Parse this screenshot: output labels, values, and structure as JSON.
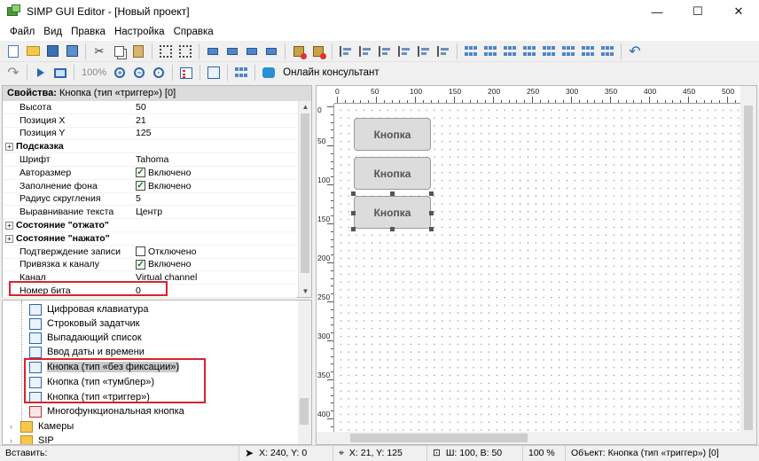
{
  "window": {
    "title": "SIMP GUI Editor - [Новый проект]",
    "minimize": "—",
    "maximize": "☐",
    "close": "✕"
  },
  "menu": [
    "Файл",
    "Вид",
    "Правка",
    "Настройка",
    "Справка"
  ],
  "toolbar2": {
    "zoom": "100%",
    "consultant": "Онлайн консультант"
  },
  "properties": {
    "title_prefix": "Свойства:",
    "title_object": " Кнопка (тип «триггер») [0]",
    "rows": [
      {
        "name": "Высота",
        "value": "50"
      },
      {
        "name": "Позиция X",
        "value": "21"
      },
      {
        "name": "Позиция Y",
        "value": "125"
      },
      {
        "name": "Подсказка",
        "group": true
      },
      {
        "name": "Шрифт",
        "value": "Tahoma"
      },
      {
        "name": "Авторазмер",
        "value": "Включено",
        "check": true
      },
      {
        "name": "Заполнение фона",
        "value": "Включено",
        "check": true
      },
      {
        "name": "Радиус скругления",
        "value": "5"
      },
      {
        "name": "Выравнивание текста",
        "value": "Центр"
      },
      {
        "name": "Состояние \"отжато\"",
        "group": true
      },
      {
        "name": "Состояние \"нажато\"",
        "group": true
      },
      {
        "name": "Подтверждение записи",
        "value": "Отключено",
        "check": false
      },
      {
        "name": "Привязка к каналу",
        "value": "Включено",
        "check": true
      },
      {
        "name": "Канал",
        "value": "Virtual channel"
      },
      {
        "name": "Номер бита",
        "value": "0"
      }
    ],
    "group_sign": "+",
    "check_mark": "✓"
  },
  "tree": {
    "items": [
      {
        "label": "Цифровая клавиатура",
        "icon": "keypad-icon"
      },
      {
        "label": "Строковый задатчик",
        "icon": "string-input-icon"
      },
      {
        "label": "Выпадающий список",
        "icon": "dropdown-icon"
      },
      {
        "label": "Ввод даты и времени",
        "icon": "datetime-icon"
      },
      {
        "label": "Кнопка (тип «без фиксации»)",
        "icon": "button-icon",
        "selected": true
      },
      {
        "label": "Кнопка (тип «тумблер»)",
        "icon": "button-icon"
      },
      {
        "label": "Кнопка (тип «триггер»)",
        "icon": "button-icon"
      },
      {
        "label": "Многофункциональная кнопка",
        "icon": "multi-button-icon"
      },
      {
        "label": "Камеры",
        "icon": "folder-icon"
      },
      {
        "label": "SIP",
        "icon": "folder-icon"
      }
    ]
  },
  "canvas": {
    "hruler_labels": [
      "0",
      "50",
      "100",
      "150",
      "200",
      "250",
      "300",
      "350",
      "400",
      "450",
      "500"
    ],
    "vruler_labels": [
      "0",
      "50",
      "100",
      "150",
      "200",
      "250",
      "300",
      "350",
      "400"
    ],
    "buttons": [
      "Кнопка",
      "Кнопка",
      "Кнопка"
    ]
  },
  "status": {
    "insert": "Вставить:",
    "cursor": "X: 240, Y: 0",
    "position": "X: 21, Y: 125",
    "size": "Ш: 100, В: 50",
    "zoom": "100 %",
    "object": "Объект: Кнопка (тип «триггер») [0]"
  },
  "colors": {
    "highlight_border": "#d9232d",
    "accent": "#2b66b0"
  }
}
